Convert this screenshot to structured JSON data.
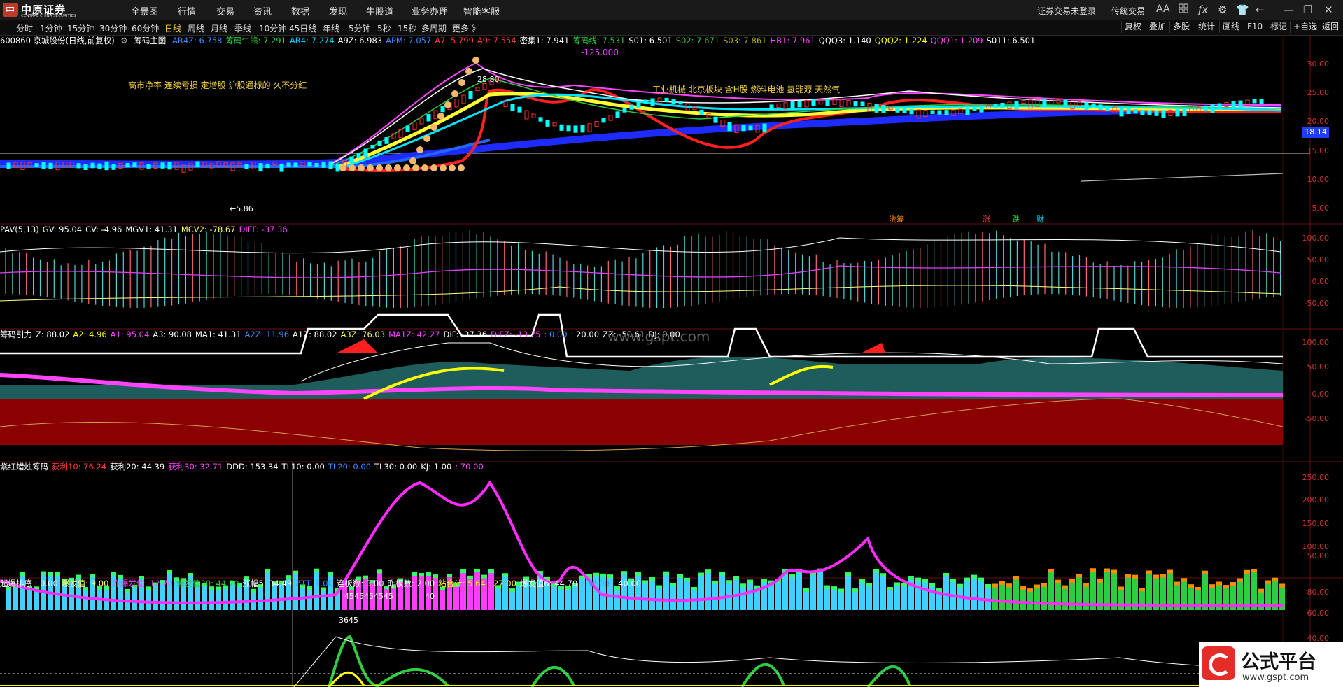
{
  "app": {
    "logo_text": "中原证券",
    "logo_sub": "CENTRAL CHINA SECURITIES"
  },
  "menu": [
    "全景图",
    "行情",
    "交易",
    "资讯",
    "数据",
    "发现",
    "牛股道",
    "业务办理",
    "智能客服"
  ],
  "topright": {
    "login": "证券交易未登录",
    "trade": "传统交易",
    "icons": [
      "AA",
      "grid-icon",
      "fx-icon",
      "gear-icon",
      "shirt-icon",
      "back-icon",
      "minimize-icon",
      "restore-icon",
      "close-icon"
    ]
  },
  "periods": [
    "分时",
    "1分钟",
    "15分钟",
    "30分钟",
    "60分钟",
    "日线",
    "周线",
    "月线",
    "季线",
    "10分钟",
    "45日线",
    "年线",
    "5分钟",
    "5秒",
    "15秒",
    "多周期",
    "更多 》"
  ],
  "active_period": "日线",
  "right_buttons": [
    "复权",
    "叠加",
    "多股",
    "统计",
    "画线",
    "F10",
    "标记",
    "+自选",
    "返回"
  ],
  "pane1": {
    "stock": "600860 京城股份(日线,前复权)",
    "indicator": "筹码主图",
    "items": [
      {
        "t": "AR4Z: 6.758",
        "c": "#3b8cff"
      },
      {
        "t": "筹码牛熊: 7.291",
        "c": "#2ecc40"
      },
      {
        "t": "AR4: 7.274",
        "c": "#00d5ff"
      },
      {
        "t": "A9Z: 6.983",
        "c": "#ffffff"
      },
      {
        "t": "APM: 7.057",
        "c": "#3b8cff"
      },
      {
        "t": "A7: 5.799",
        "c": "#ff3b3b"
      },
      {
        "t": "A9: 7.554",
        "c": "#ff3b3b"
      },
      {
        "t": "密集1: 7.941",
        "c": "#ffffff"
      },
      {
        "t": "筹码线: 7.531",
        "c": "#2ecc40"
      },
      {
        "t": "S01: 6.501",
        "c": "#ffffff"
      },
      {
        "t": "S02: 7.671",
        "c": "#2ecc40"
      },
      {
        "t": "S03: 7.861",
        "c": "#b8b800"
      },
      {
        "t": "HB1: 7.961",
        "c": "#ff44ff"
      },
      {
        "t": "QQQ3: 1.140",
        "c": "#ffffff"
      },
      {
        "t": "QQQ2: 1.224",
        "c": "#ffff00"
      },
      {
        "t": "QQQ1: 1.209",
        "c": "#ff44ff"
      },
      {
        "t": "S011: 6.501",
        "c": "#ffffff"
      }
    ],
    "sub_value": "-125.000",
    "high_label": "28.80",
    "low_label": "←5.86",
    "price_tag": "18.14",
    "concept_left": "高市净率 连续亏损 定增股 沪股通标的 久不分红",
    "concept_right": "工业机械 北京板块 含H股 燃料电池 氢能源 天然气",
    "events": [
      {
        "t": "洗筹",
        "c": "#ff8c00"
      },
      {
        "t": "涨",
        "c": "#ff4040"
      },
      {
        "t": "跌",
        "c": "#2ecc40"
      },
      {
        "t": "财",
        "c": "#00ccff"
      }
    ],
    "y_ticks": [
      "30.00",
      "25.00",
      "20.00",
      "15.00",
      "10.00",
      "5.00"
    ]
  },
  "pane2": {
    "items": [
      {
        "t": "PAV(5,13)",
        "c": "#ffffff"
      },
      {
        "t": "GV: 95.04",
        "c": "#ffffff"
      },
      {
        "t": "CV: -4.96",
        "c": "#ffffff"
      },
      {
        "t": "MGV1: 41.31",
        "c": "#ffffff"
      },
      {
        "t": "MCV2: -78.67",
        "c": "#ffff66"
      },
      {
        "t": "DIFF: -37.36",
        "c": "#ff44ff"
      }
    ],
    "y_ticks": [
      "100.00",
      "50.00",
      "0.00",
      "-50.00"
    ]
  },
  "pane3": {
    "items": [
      {
        "t": "筹码引力",
        "c": "#ffffff"
      },
      {
        "t": "Z: 88.02",
        "c": "#ffffff"
      },
      {
        "t": "A2: 4.96",
        "c": "#ffff00"
      },
      {
        "t": "A1: 95.04",
        "c": "#ff44ff"
      },
      {
        "t": "A3: 90.08",
        "c": "#ffffff"
      },
      {
        "t": "MA1: 41.31",
        "c": "#ffffff"
      },
      {
        "t": "A2Z: 11.96",
        "c": "#3b8cff"
      },
      {
        "t": "A1Z: 88.02",
        "c": "#ffffff"
      },
      {
        "t": "A3Z: 76.03",
        "c": "#ffff66"
      },
      {
        "t": "MA1Z: 42.27",
        "c": "#ff44ff"
      },
      {
        "t": "DIF: -37.36",
        "c": "#ffffff"
      },
      {
        "t": "DIFZ: -13.25",
        "c": "#ff44ff"
      },
      {
        "t": ": 0.00",
        "c": "#3b8cff"
      },
      {
        "t": ": 20.00",
        "c": "#ffffff"
      },
      {
        "t": "ZZ: -50.61",
        "c": "#ffffff"
      },
      {
        "t": "DJ: 0.00",
        "c": "#ffffff"
      }
    ],
    "watermark": "www.gspt.com",
    "y_ticks": [
      "100.00",
      "50.00",
      "0.00",
      "-50.00"
    ]
  },
  "pane4": {
    "items": [
      {
        "t": "紫红蜡烛筹码",
        "c": "#ffffff"
      },
      {
        "t": "获利10: 76.24",
        "c": "#ff3b3b"
      },
      {
        "t": "获利20: 44.39",
        "c": "#ffffff"
      },
      {
        "t": "获利30: 32.71",
        "c": "#ff44ff"
      },
      {
        "t": "DDD: 153.34",
        "c": "#ffffff"
      },
      {
        "t": "TL10: 0.00",
        "c": "#ffffff"
      },
      {
        "t": "TL20: 0.00",
        "c": "#3b8cff"
      },
      {
        "t": "TL30: 0.00",
        "c": "#ffffff"
      },
      {
        "t": "KJ: 1.00",
        "c": "#ffffff"
      },
      {
        "t": ": 70.00",
        "c": "#ff44ff"
      }
    ],
    "y_ticks": [
      "250.00",
      "200.00",
      "150.00",
      "100.00",
      "50.00"
    ]
  },
  "pane5": {
    "items": [
      {
        "t": "起爆排序 : 0.00",
        "c": "#ffffff"
      },
      {
        "t": "爆发值: 9.00",
        "c": "#ffff66"
      },
      {
        "t": "昨爆发值: 12.70",
        "c": "#ff44ff"
      },
      {
        "t": "爆发值30: 44.70",
        "c": "#2ecc40"
      },
      {
        "t": "涨幅5: 34.49",
        "c": "#ffffff"
      },
      {
        "t": "ZTT: 1.00",
        "c": "#3b8cff"
      },
      {
        "t": "连板数: 3.00",
        "c": "#ffffff"
      },
      {
        "t": "昨板数: 2.00",
        "c": "#ffffff"
      },
      {
        "t": "粘合计: 5.64 : 27.00",
        "c": "#ffff00"
      },
      {
        "t": "爆发值6: 44.70",
        "c": "#ffffff"
      },
      {
        "t": ": 32.00",
        "c": "#3b8cff"
      },
      {
        "t": ": 40.00",
        "c": "#ffffff"
      }
    ],
    "label_a": "4545454545",
    "label_b": "40",
    "label_c": "3645",
    "y_ticks": [
      "80.00",
      "60.00",
      "40.00"
    ]
  },
  "brand": {
    "name": "公式平台",
    "url": "www.gspt.com"
  },
  "colors": {
    "bg": "#000000",
    "axis": "#cc3333",
    "grid": "#5a0f0f",
    "active": "#f4d03f"
  }
}
